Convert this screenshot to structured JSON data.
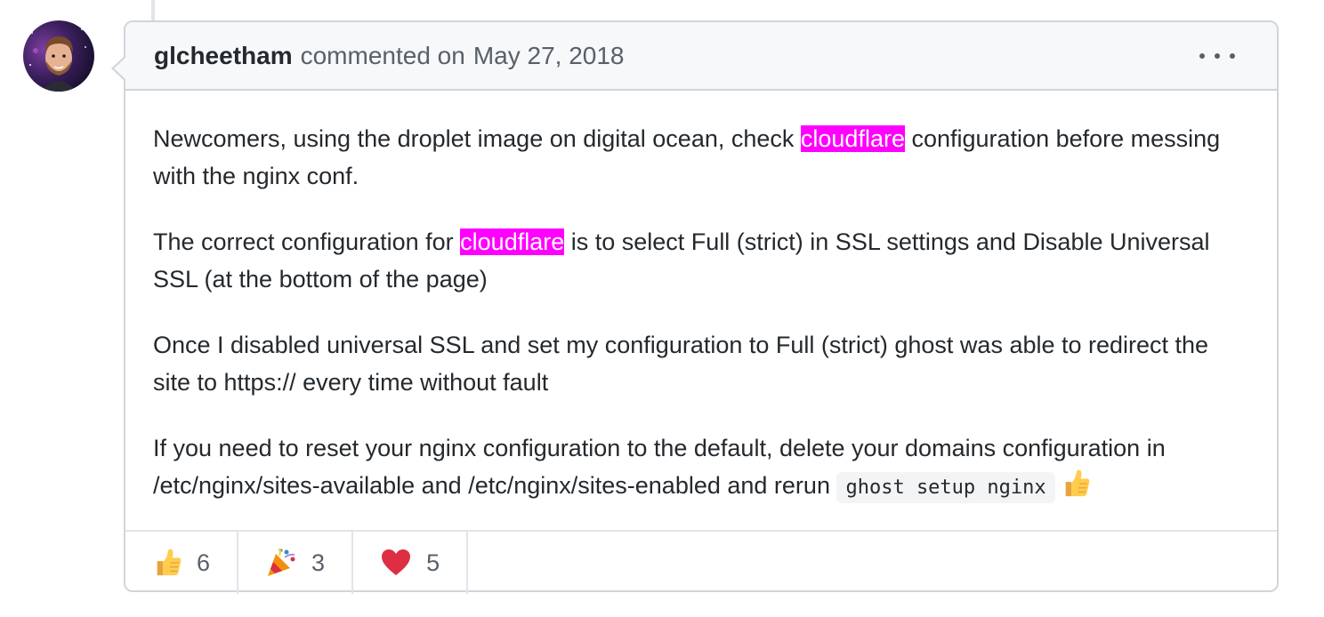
{
  "comment": {
    "author": "glcheetham",
    "action": "commented on",
    "date": "May 27, 2018",
    "menu_icon": "kebab-horizontal-icon",
    "highlight_color": "#ff00ff",
    "paragraphs": {
      "p1": {
        "before": "Newcomers, using the droplet image on digital ocean, check ",
        "highlight": "cloudflare",
        "after": " configuration before messing with the nginx conf."
      },
      "p2": {
        "before": "The correct configuration for ",
        "highlight": "cloudflare",
        "after": " is to select Full (strict) in SSL settings and Disable Universal SSL (at the bottom of the page)"
      },
      "p3": {
        "text": "Once I disabled universal SSL and set my configuration to Full (strict) ghost was able to redirect the site to https:// every time without fault"
      },
      "p4": {
        "before": "If you need to reset your nginx configuration to the default, delete your domains configuration in /etc/nginx/sites-available and /etc/nginx/sites-enabled and rerun ",
        "code": "ghost setup nginx",
        "emoji": "thumbs-up-icon"
      }
    }
  },
  "reactions": [
    {
      "icon": "thumbs-up-icon",
      "count": "6"
    },
    {
      "icon": "party-popper-icon",
      "count": "3"
    },
    {
      "icon": "heart-icon",
      "count": "5"
    }
  ]
}
